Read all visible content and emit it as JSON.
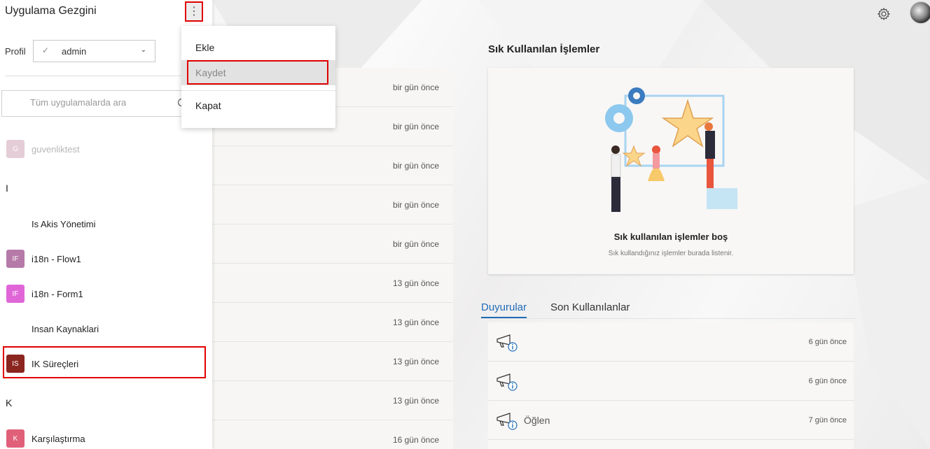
{
  "window": {
    "title": "Uygulama Gezgini"
  },
  "topbar": {
    "settings_icon": "gear-icon",
    "avatar": "user-avatar"
  },
  "profile": {
    "label": "Profil",
    "value": "admin"
  },
  "search": {
    "placeholder": "Tüm uygulamalarda ara"
  },
  "menu": {
    "items": [
      {
        "label": "Ekle"
      },
      {
        "label": "Kaydet"
      },
      {
        "label": "Kapat"
      }
    ]
  },
  "apps": {
    "item_g": {
      "badge": "G",
      "name": "guvenliktest",
      "color": "#d9b8c6"
    },
    "group_i": "I",
    "item_isakis": {
      "name": "Is Akis Yönetimi"
    },
    "item_flow": {
      "badge": "IF",
      "name": "i18n - Flow1",
      "color": "#b67aa8"
    },
    "item_form": {
      "badge": "IF",
      "name": "i18n - Form1",
      "color": "#e066d8"
    },
    "item_insan": {
      "name": "Insan Kaynaklari"
    },
    "item_ik": {
      "badge": "IS",
      "name": "IK Süreçleri",
      "color": "#8b2520"
    },
    "group_k": "K",
    "item_kars": {
      "badge": "K",
      "name": "Karşılaştırma",
      "color": "#e0607a"
    }
  },
  "activity": {
    "times": [
      "bir gün önce",
      "bir gün önce",
      "bir gün önce",
      "bir gün önce",
      "bir gün önce",
      "13 gün önce",
      "13 gün önce",
      "13 gün önce",
      "13 gün önce",
      "16 gün önce"
    ]
  },
  "frequent": {
    "title": "Sık Kullanılan İşlemler",
    "empty_title": "Sık kullanılan işlemler boş",
    "empty_subtitle": "Sık kullandığınız işlemler burada listenir."
  },
  "tabs": {
    "announcements": "Duyurular",
    "recent": "Son Kullanılanlar"
  },
  "announcements": [
    {
      "text": "",
      "time": "6 gün önce"
    },
    {
      "text": "",
      "time": "6 gün önce"
    },
    {
      "text": "Öğlen",
      "time": "7 gün önce"
    }
  ],
  "colors": {
    "accent": "#1f6bb8",
    "highlight": "#e00000"
  }
}
